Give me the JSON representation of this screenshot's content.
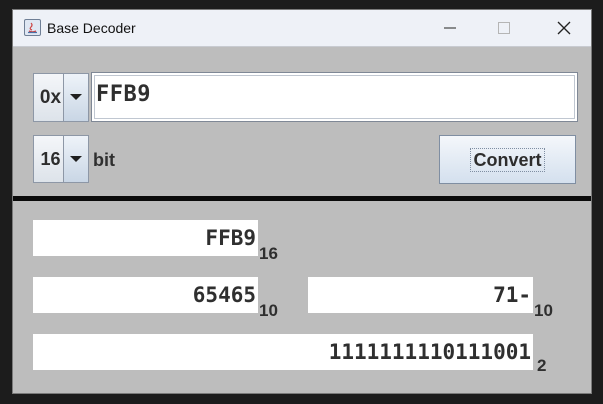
{
  "window": {
    "title": "Base Decoder"
  },
  "input": {
    "prefix": "0x",
    "value": "FFB9",
    "bits": "16",
    "bits_label": "bit",
    "convert_label": "Convert"
  },
  "outputs": {
    "hex": {
      "value": "FFB9",
      "base": "16"
    },
    "unsigned": {
      "value": "65465",
      "base": "10"
    },
    "signed": {
      "value": "71-",
      "base": "10"
    },
    "binary": {
      "value": "1111111110111001",
      "base": "2"
    }
  },
  "colors": {
    "window_bg": "#bdbdbd",
    "divider": "#0b0b0b",
    "titlebar": "#eef1f7"
  },
  "icons": [
    "java-app-icon",
    "minimize-icon",
    "maximize-icon",
    "close-icon",
    "dropdown-arrow-icon"
  ]
}
